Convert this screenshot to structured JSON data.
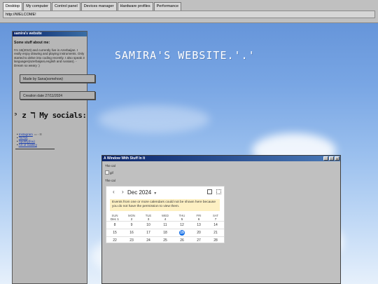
{
  "tabs": [
    "Desktop",
    "My computer",
    "Control panel",
    "Devices manager",
    "Hardware profiles",
    "Performance"
  ],
  "address": "http://WELCOME!",
  "hero_title": "SAMIRA'S WEBSITE.'.'",
  "sidebar": {
    "window_title": "samira's website",
    "about_heading": "Some stuff about me:",
    "about_text": "I'm 16(2010) and currently live in Azerbaijan. I really enjoy drawing and playing instruments. Only started to delve into coding recently. I also speak 3 languages(azerbaijani,english and russian). - Dream so weary :)",
    "made_by": "Made by Sana(somehow)",
    "creation_date": "Creation date 27/11/2024",
    "socials_title": "ᵓ z ℸ My socials:",
    "links": [
      {
        "label": "Instagram"
      },
      {
        "label": "TikTok"
      },
      {
        "label": "Spotify(fou)"
      },
      {
        "label": "Art of Gallery"
      }
    ]
  },
  "window": {
    "title": "A Window With Stuff In It",
    "buttons": [
      "_",
      "□",
      "×"
    ],
    "text1": "The cal",
    "img_alt": "gif",
    "text2": "The cal"
  },
  "calendar": {
    "month_label": "Dec 2024",
    "nav_prev": "‹",
    "nav_next": "›",
    "notice": "Events from one or more calendars could not be shown here because you do not have the permission to view them.",
    "day_headers": [
      "SUN",
      "MON",
      "TUE",
      "WED",
      "THU",
      "FRI",
      "SAT"
    ],
    "first_row_dates": [
      "Dec 1",
      "2",
      "3",
      "4",
      "5",
      "6",
      "7"
    ],
    "weeks": [
      [
        "8",
        "9",
        "10",
        "11",
        "12",
        "13",
        "14"
      ],
      [
        "15",
        "16",
        "17",
        "18",
        "19",
        "20",
        "21"
      ],
      [
        "22",
        "23",
        "24",
        "25",
        "26",
        "27",
        "28"
      ]
    ],
    "today": "19",
    "accent": "#1a73e8",
    "notice_bg": "#fdf0c3"
  }
}
